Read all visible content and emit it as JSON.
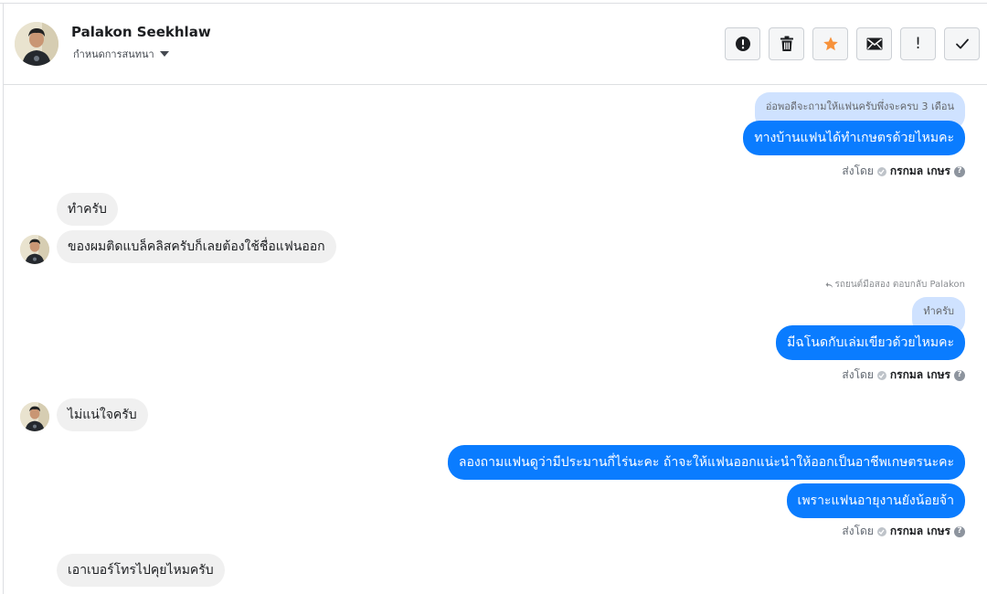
{
  "header": {
    "name": "Palakon Seekhlaw",
    "assign_label": "กำหนดการสนทนา"
  },
  "toolbar": {
    "buttons": [
      {
        "icon": "alert-circle-icon"
      },
      {
        "icon": "trash-icon"
      },
      {
        "icon": "star-icon",
        "color": "#f7923b"
      },
      {
        "icon": "envelope-icon"
      },
      {
        "icon": "exclamation-icon",
        "text": "!"
      },
      {
        "icon": "checkmark-icon"
      }
    ]
  },
  "messages": {
    "m1_quote": "อ่อพอดีจะถามให้แฟนครับพึ่งจะครบ 3 เดือน",
    "m1_text": "ทางบ้านแฟนได้ทำเกษตรด้วยไหมคะ",
    "m1_sent_prefix": "ส่งโดย",
    "m1_sender": "กรกมล เกษร",
    "m2_text": "ทำครับ",
    "m3_text": "ของผมติดแบล็คลิสครับก็เลยต้องใช้ชื่อแฟนออก",
    "m4_reply_note": "รถยนต์มือสอง ตอบกลับ Palakon",
    "m4_quote": "ทำครับ",
    "m4_text": "มีฉโนดกับเล่มเขียวด้วยไหมคะ",
    "m4_sent_prefix": "ส่งโดย",
    "m4_sender": "กรกมล เกษร",
    "m5_text": "ไม่แน่ใจครับ",
    "m6_text": "ลองถามแฟนดูว่ามีประมานกี่ไร่นะคะ ถ้าจะให้แฟนออกแน่ะนำให้ออกเป็นอาชีพเกษตรนะคะ",
    "m7_text": "เพราะแฟนอายุงานยังน้อยจ้า",
    "m7_sent_prefix": "ส่งโดย",
    "m7_sender": "กรกมล เกษร",
    "m8_text": "เอาเบอร์โทรไปคุยไหมครับ"
  },
  "colors": {
    "outgoing_bubble": "#0a7cff",
    "incoming_bubble": "#f0f0f0",
    "quote_bubble": "#cfe2ff"
  }
}
